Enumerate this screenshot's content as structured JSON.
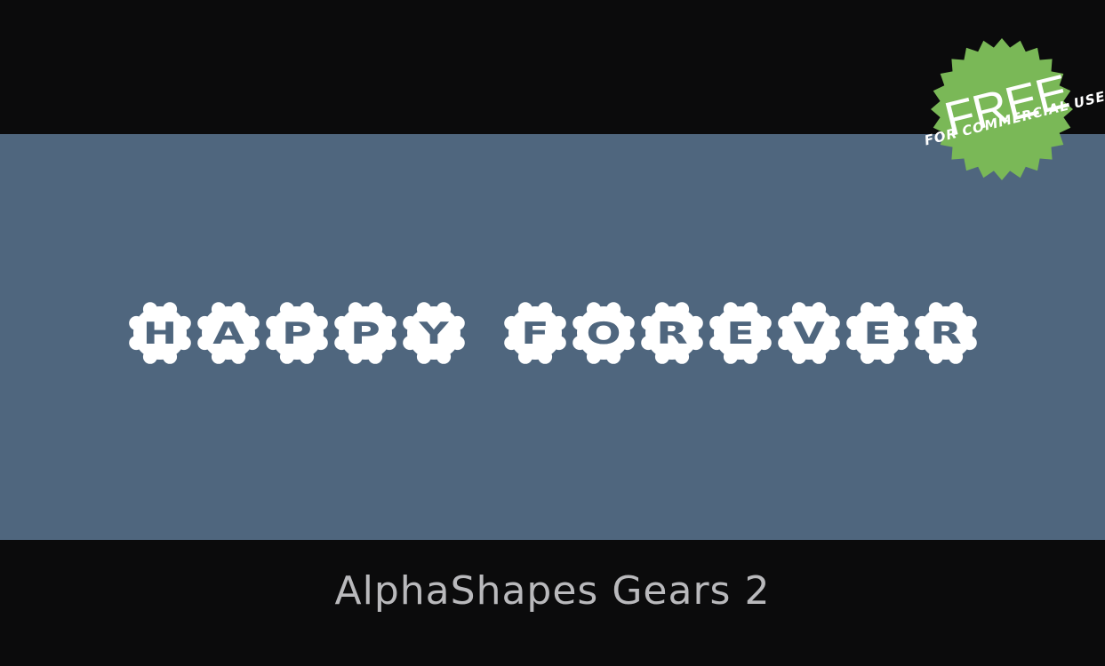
{
  "preview": {
    "sample_text": "HAPPY FOREVER",
    "background_color": "#4f667e",
    "glyph_color": "#ffffff",
    "letter_color": "#4f667e"
  },
  "font_name": "AlphaShapes Gears 2",
  "badge": {
    "title": "FREE",
    "subtitle": "FOR COMMERCIAL USE",
    "color": "#7ab857"
  }
}
